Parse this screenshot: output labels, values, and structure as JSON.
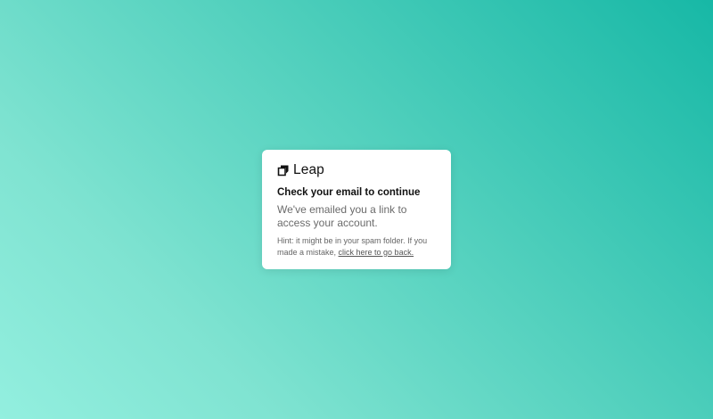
{
  "brand": {
    "name": "Leap",
    "icon": "leap-logo-icon"
  },
  "card": {
    "heading": "Check your email to continue",
    "message": "We've emailed you a link to access your account.",
    "hint_prefix": "Hint: it might be in your spam folder. If you made a mistake, ",
    "hint_link": "click here to go back."
  },
  "colors": {
    "background_start": "#93efdf",
    "background_end": "#17b8a6",
    "card_background": "#ffffff",
    "heading_text": "#111111",
    "body_text": "#6b6b6b"
  }
}
